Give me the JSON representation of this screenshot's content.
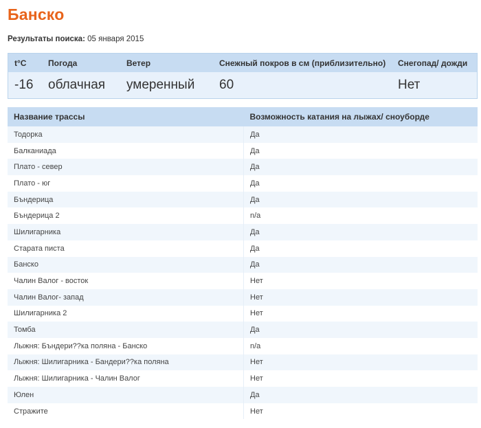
{
  "page": {
    "title": "Банско",
    "search_label": "Результаты поиска:",
    "search_date": "05 января 2015"
  },
  "weather": {
    "headers": {
      "temp": "t°C",
      "weather": "Погода",
      "wind": "Ветер",
      "snow": "Снежный покров в см (приблизительно)",
      "snowfall": "Снегопад/ дожди"
    },
    "values": {
      "temp": "-16",
      "weather": "облачная",
      "wind": "умеренный",
      "snow": "60",
      "snowfall": "Нет"
    }
  },
  "tracks": {
    "headers": {
      "name": "Название трассы",
      "status": "Возможность катания на лыжах/ сноуборде"
    },
    "rows": [
      {
        "name": "Тодорка",
        "status": "Да"
      },
      {
        "name": "Балканиада",
        "status": "Да"
      },
      {
        "name": "Плато - север",
        "status": "Да"
      },
      {
        "name": "Плато - юг",
        "status": "Да"
      },
      {
        "name": "Бъндерица",
        "status": "Да"
      },
      {
        "name": "Бъндерица 2",
        "status": "n/a"
      },
      {
        "name": "Шилигарника",
        "status": "Да"
      },
      {
        "name": "Старата писта",
        "status": "Да"
      },
      {
        "name": "Банско",
        "status": "Да"
      },
      {
        "name": "Чалин Валог - восток",
        "status": "Нет"
      },
      {
        "name": "Чалин Валог- запад",
        "status": "Нет"
      },
      {
        "name": "Шилигарника 2",
        "status": "Нет"
      },
      {
        "name": "Томба",
        "status": "Да"
      },
      {
        "name": "Лыжня: Бъндери??ка поляна - Банско",
        "status": "n/a"
      },
      {
        "name": "Лыжня: Шилигарника - Бандери??ка поляна",
        "status": "Нет"
      },
      {
        "name": "Лыжня: Шилигарника - Чалин Валог",
        "status": "Нет"
      },
      {
        "name": "Юлен",
        "status": "Да"
      },
      {
        "name": "Стражите",
        "status": "Нет"
      }
    ]
  }
}
